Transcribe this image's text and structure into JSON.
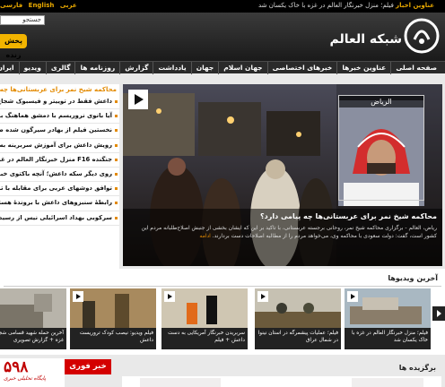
{
  "topbar": {
    "ticker_label": "عناوین اخبار",
    "ticker_text": "فیلم؛ منزل خبرنگار العالم در غزه با خاک یکسان شد",
    "languages": [
      "عربی",
      "English",
      "فارسی"
    ]
  },
  "header": {
    "search_placeholder": "جستجو",
    "live_label": "پخش زنده",
    "site_name": "شبکه العالم"
  },
  "nav": {
    "items": [
      "صفحه اصلی",
      "عناوین خبرها",
      "خبرهای اختصاصی",
      "جهان اسلام",
      "جهان",
      "یادداشت",
      "گزارش",
      "روزنامه ها",
      "گالری",
      "ویدیو",
      "ایران"
    ]
  },
  "sidebar": {
    "heading": "محاکمه شیخ نمر برای عربستانی‌ها چه پیامی دارد؟",
    "items": [
      "داعش فقط در توییتر و فیسبوک شجاع است + ا",
      "آیا بانوی نروریسم با دمشق هماهنگ باشم؟",
      "نخستین فیلم از بهادر سیرگون شده صهیونیسم",
      "رویش داعش برای آموزش سربرینه به کودکان +",
      "جنگنده F16 منزل خبرنگار العالم در غزه را ویران کرد",
      "روی دیگر سکه داعش؛ آنچه باکتوی خبری نیست",
      "توافق دوشهای عربی برای مقابله با تروریسم",
      "رابطهٔ سنبزوهای داعش با بروندهٔ هسته‌ای ایر",
      "سرکوبی بهداد اسرائیلی نیس از رسیدن به عظیم"
    ]
  },
  "featured": {
    "inset_label": "الریاض",
    "title": "محاکمه شیخ نمر برای عربستانی‌ها چه پیامی دارد؟",
    "body": "ریاض، العالم - برگزاری محاکمه شیخ نمر، روحانی برجسته عربستانی، با تاکید بر این که ایشان بخشی از جنبش اصلاح‌طلبانه مردم این کشور است، گفت: دولت سعودی با محاکمه وی، می‌خواهد مردم را از مطالبه اصلاحات دست بردارند.",
    "more_label": "ادامه"
  },
  "videos": {
    "title": "آخرین ویدیوها",
    "items": [
      "فیلم؛ منزل خبرنگار العالم در غزه با خاک یکسان شد",
      "فیلم؛ عملیات پیشمرگه در استان نینوا در شمال عراق",
      "سربریدن خبرنگار آمریکایی به دست داعش + فیلم",
      "فیلم ویدیو: نیصب کودک تروریست داعش",
      "آخرین حمله شهید قسامی شجاعیه غزه + گزارش تصویری"
    ]
  },
  "bottom": {
    "breaking_label": "خبر فوری",
    "ad_number": "۵۹۸",
    "ad_caption": "پایگاه تحلیلی خبری",
    "featured_title": "برگزیده ها"
  },
  "colors": {
    "accent": "#f2b400",
    "breaking": "#d40000",
    "link": "#e38a00"
  }
}
